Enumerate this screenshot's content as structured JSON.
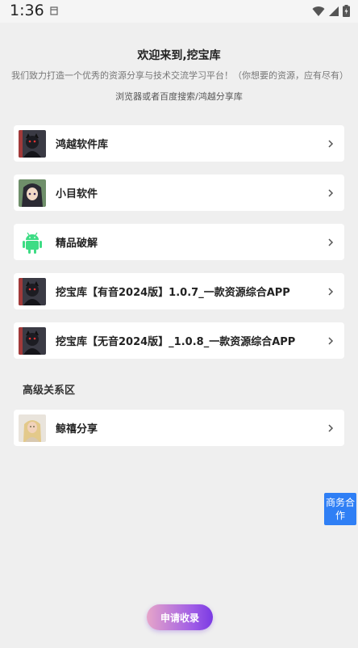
{
  "status_bar": {
    "time": "1:36"
  },
  "header": {
    "title": "欢迎来到,挖宝库",
    "description": "我们致力打造一个优秀的资源分享与技术交流学习平台！（你想要的资源，应有尽有）",
    "subtitle": "浏览器或者百度搜索/鸿越分享库"
  },
  "items": [
    {
      "label": "鸿越软件库",
      "thumb": "dark-character-avatar"
    },
    {
      "label": "小目软件",
      "thumb": "anime-girl-avatar"
    },
    {
      "label": "精品破解",
      "thumb": "android-icon"
    },
    {
      "label": "挖宝库【有音2024版】1.0.7_一款资源综合APP",
      "thumb": "dark-character-avatar"
    },
    {
      "label": "挖宝库【无音2024版】_1.0.8_一款资源综合APP",
      "thumb": "dark-character-avatar"
    }
  ],
  "section": {
    "title": "高级关系区"
  },
  "advanced_items": [
    {
      "label": "鲸禧分享",
      "thumb": "blonde-woman-avatar"
    }
  ],
  "floating": {
    "business_label": "商务合作",
    "apply_label": "申请收录"
  },
  "colors": {
    "accent_blue": "#2f7ff5",
    "apply_gradient_start": "#e6a5c9",
    "apply_gradient_end": "#7a3ae3",
    "android_green": "#3ddc84"
  }
}
